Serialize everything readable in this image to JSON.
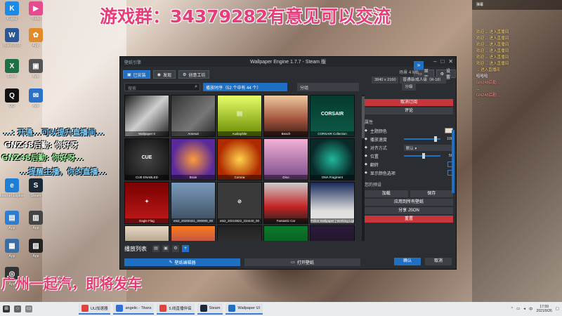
{
  "overlay": {
    "title_banner": "游戏群：34379282有意见可以交流",
    "bottom_banner": "广州一起汽，即将发车",
    "danmu": [
      {
        "text": "...: 开通...可以提升直播间...",
        "color": "#7fd3ff"
      },
      {
        "text": "GNZ48后勤: 你好呀",
        "color": "#ffffff"
      },
      {
        "text": "GNZ48后勤: 你好呀...",
        "color": "#9cf59c"
      },
      {
        "text": "...提醒主播，你的直播...",
        "color": "#7fd3ff"
      }
    ]
  },
  "desktop_icons": [
    {
      "label": "Kugou",
      "glyph": "K",
      "color": "#1c8ae6"
    },
    {
      "label": "Youku",
      "glyph": "▶",
      "color": "#e64b8f"
    },
    {
      "label": "Word 2016",
      "glyph": "W",
      "color": "#2b5797"
    },
    {
      "label": "App",
      "glyph": "✿",
      "color": "#e08a2a"
    },
    {
      "label": "Excel",
      "glyph": "X",
      "color": "#1e7145"
    },
    {
      "label": "App",
      "glyph": "▣",
      "color": "#555"
    },
    {
      "label": "QQ",
      "glyph": "Q",
      "color": "#111"
    },
    {
      "label": "App",
      "glyph": "✉",
      "color": "#2b70c9"
    },
    {
      "label": "Internet Explorer",
      "glyph": "e",
      "color": "#1d7fd6"
    },
    {
      "label": "Steam",
      "glyph": "S",
      "color": "#1b2838"
    },
    {
      "label": "App",
      "glyph": "▤",
      "color": "#2d7dd2"
    },
    {
      "label": "App",
      "glyph": "▥",
      "color": "#444"
    },
    {
      "label": "App",
      "glyph": "▦",
      "color": "#3a6ea5"
    },
    {
      "label": "App",
      "glyph": "▧",
      "color": "#222"
    },
    {
      "label": "App",
      "glyph": "◎",
      "color": "#333"
    }
  ],
  "chat": {
    "header": "弹幕",
    "messages": [
      {
        "text": "欢迎 ... 进入直播间",
        "color": "#ffd86b"
      },
      {
        "text": "欢迎 ... 进入直播间",
        "color": "#ffd86b"
      },
      {
        "text": "欢迎 ... 进入直播间",
        "color": "#ffd86b"
      },
      {
        "text": "欢迎 ... 进入直播间",
        "color": "#ffd86b"
      },
      {
        "text": "欢迎 ... 进入直播间",
        "color": "#ffd86b"
      },
      {
        "text": "欢迎 ... 进入直播间",
        "color": "#ffd86b"
      },
      {
        "text": "... 进入直播间",
        "color": "#ffd86b"
      },
      {
        "text": "哈哈哈",
        "color": "#ffffff"
      },
      {
        "text": "GNZ48后勤 ...",
        "color": "#ff8a8a"
      },
      {
        "text": "...",
        "color": "#ffffff"
      },
      {
        "text": "GNZ48后勤 ...",
        "color": "#ff8a8a"
      },
      {
        "text": "...",
        "color": "#ff8a8a"
      }
    ]
  },
  "window": {
    "app_label": "壁纸引擎",
    "title": "Wallpaper Engine 1.7.7 - Steam 版",
    "tabs": [
      {
        "label": "已安装",
        "active": true
      },
      {
        "label": "发现",
        "active": false
      },
      {
        "label": "创意工坊",
        "active": false
      }
    ],
    "top_right_buttons": [
      "显示",
      "设置"
    ],
    "search_placeholder": "搜索",
    "sort_label": "播放时序（52 个中有 44 个）",
    "filter_label": "分组",
    "tiles": [
      {
        "caption": "Wallpaper 0",
        "bg": "linear-gradient(135deg,#1c1c1c,#cfcfcf 50%,#222)",
        "text": ""
      },
      {
        "caption": "Arsenal",
        "bg": "linear-gradient(135deg,#333,#777 60%,#2a2a2a)",
        "text": ""
      },
      {
        "caption": "Audiophile",
        "bg": "linear-gradient(180deg,#e5ff6a,#6a8a00)",
        "text": "||||"
      },
      {
        "caption": "Beach",
        "bg": "linear-gradient(180deg,#f0c9a0,#a0523a 60%,#3a1f1a)",
        "text": ""
      },
      {
        "caption": "CORSAIR Collection",
        "bg": "linear-gradient(180deg,#063a2e,#0c5a48)",
        "text": "CORSAIR"
      },
      {
        "caption": "CUE ENABLED",
        "bg": "radial-gradient(circle,#444,#111)",
        "text": "CUE"
      },
      {
        "caption": "Brain",
        "bg": "radial-gradient(circle,#ff9b3a,#5a2a9a 70%)",
        "text": ""
      },
      {
        "caption": "Corona",
        "bg": "radial-gradient(circle,#ffd34a,#b02a00 70%)",
        "text": ""
      },
      {
        "caption": "Dino",
        "bg": "linear-gradient(180deg,#f3b1d6,#7a4a8a)",
        "text": ""
      },
      {
        "caption": "DNA Fragment",
        "bg": "radial-gradient(circle,#1fb89a,#0a2a2a 70%)",
        "text": ""
      },
      {
        "caption": "Eagle Flag",
        "bg": "linear-gradient(180deg,#7a0000,#c01a1a)",
        "text": "✦"
      },
      {
        "caption": "ets2_20200321_000000_00",
        "bg": "linear-gradient(180deg,#7a9bbd,#3a4a5a)",
        "text": ""
      },
      {
        "caption": "ets2_20210822_234440_00",
        "bg": "#3a3a3a",
        "text": "⊘"
      },
      {
        "caption": "Fantastic Car",
        "bg": "linear-gradient(180deg,#ccc,#c42222 60%,#222)",
        "text": ""
      },
      {
        "caption": "Police Wallpaper | Working Lights",
        "bg": "linear-gradient(180deg,#1a2a5a,#e0e0e0 70%)",
        "text": ""
      },
      {
        "caption": "",
        "bg": "linear-gradient(180deg,#e6d6c0,#6a5a4a)",
        "text": ""
      },
      {
        "caption": "",
        "bg": "linear-gradient(180deg,#ff7a1a,#5a1a8a)",
        "text": ""
      },
      {
        "caption": "",
        "bg": "linear-gradient(180deg,#222,#444)",
        "text": ""
      },
      {
        "caption": "",
        "bg": "linear-gradient(180deg,#0a7a2a,#0a3a1a)",
        "text": ""
      },
      {
        "caption": "",
        "bg": "linear-gradient(180deg,#2a1a3a,#111)",
        "text": ""
      }
    ],
    "playlist_label": "播放列表",
    "bottom_buttons": [
      {
        "label": "壁纸编辑器",
        "style": "blue"
      },
      {
        "label": "打开壁纸",
        "style": "gray"
      }
    ],
    "right_panel": {
      "size": "场景 4 MB",
      "chips": [
        "3840 x 2160",
        "普通级/成人级（R-18）",
        "分级"
      ],
      "unsubscribe": "取消订阅",
      "rate": "评论",
      "props_header": "属性",
      "props": [
        {
          "label": "主题颜色",
          "type": "color"
        },
        {
          "label": "播放速度",
          "type": "slider",
          "value": "100",
          "pos": 0.82
        },
        {
          "label": "对齐方式",
          "type": "select",
          "value": "默认"
        },
        {
          "label": "位置",
          "type": "slider",
          "value": "50",
          "pos": 0.5
        },
        {
          "label": "翻转",
          "type": "check"
        },
        {
          "label": "显示颜色选项",
          "type": "check"
        }
      ],
      "presets_header": "您的预设",
      "preset_buttons": [
        "加载",
        "保存"
      ],
      "apply_preset": "应用到所有壁纸",
      "share_json": "分享 JSON",
      "reset": "重置",
      "ok": "确认",
      "cancel": "取消"
    }
  },
  "taskbar": {
    "apps": [
      {
        "label": "UU加速器",
        "color": "#e0443e"
      },
      {
        "label": "angelic - Titans",
        "color": "#2e6fd6"
      },
      {
        "label": "5.线直播伴侣",
        "color": "#e0443e"
      },
      {
        "label": "Steam",
        "color": "#1b2838"
      },
      {
        "label": "Wallpaper UI",
        "color": "#1f6fc2"
      }
    ],
    "time": "17:59",
    "date": "2021/9/26"
  }
}
